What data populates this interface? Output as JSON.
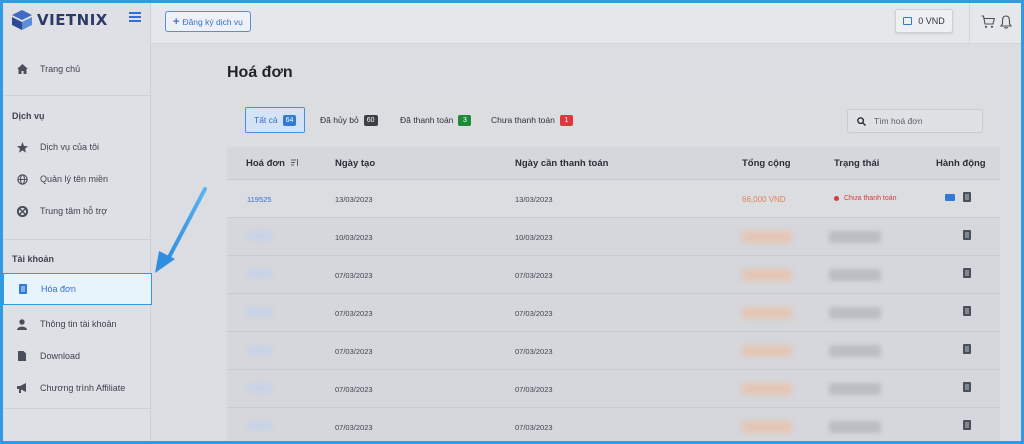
{
  "brand": {
    "name": "VIETNIX"
  },
  "topbar": {
    "register_label": "Đăng ký dịch vụ",
    "balance": "0 VND"
  },
  "sidebar": {
    "home": "Trang chủ",
    "section_services": "Dịch vụ",
    "services": [
      "Dịch vụ của tôi",
      "Quản lý tên miền",
      "Trung tâm hỗ trợ"
    ],
    "section_account": "Tài khoản",
    "account": [
      "Hóa đơn",
      "Thông tin tài khoản",
      "Download",
      "Chương trình Affiliate"
    ]
  },
  "main": {
    "title": "Hoá đơn",
    "tabs": [
      {
        "label": "Tất cả",
        "count": "64",
        "color": "#2f7bd6"
      },
      {
        "label": "Đã hủy bỏ",
        "count": "60",
        "color": "#3c3f45"
      },
      {
        "label": "Đã thanh toán",
        "count": "3",
        "color": "#1d8a3a"
      },
      {
        "label": "Chưa thanh toán",
        "count": "1",
        "color": "#d73a3a"
      }
    ],
    "search_placeholder": "Tìm hoá đơn",
    "columns": [
      "Hoá đơn",
      "Ngày tạo",
      "Ngày cần thanh toán",
      "Tổng cộng",
      "Trạng thái",
      "Hành động"
    ],
    "rows": [
      {
        "invoice": "119525",
        "created": "13/03/2023",
        "due": "13/03/2023",
        "total": "66,000 VND",
        "status": "Chưa thanh toán"
      },
      {
        "created": "10/03/2023",
        "due": "10/03/2023"
      },
      {
        "created": "07/03/2023",
        "due": "07/03/2023"
      },
      {
        "created": "07/03/2023",
        "due": "07/03/2023"
      },
      {
        "created": "07/03/2023",
        "due": "07/03/2023"
      },
      {
        "created": "07/03/2023",
        "due": "07/03/2023"
      },
      {
        "created": "07/03/2023",
        "due": "07/03/2023"
      }
    ]
  },
  "colors": {
    "accent": "#2f9be3",
    "link": "#2f6fd6",
    "unpaid": "#d73a3a",
    "amount": "#e0825a"
  }
}
